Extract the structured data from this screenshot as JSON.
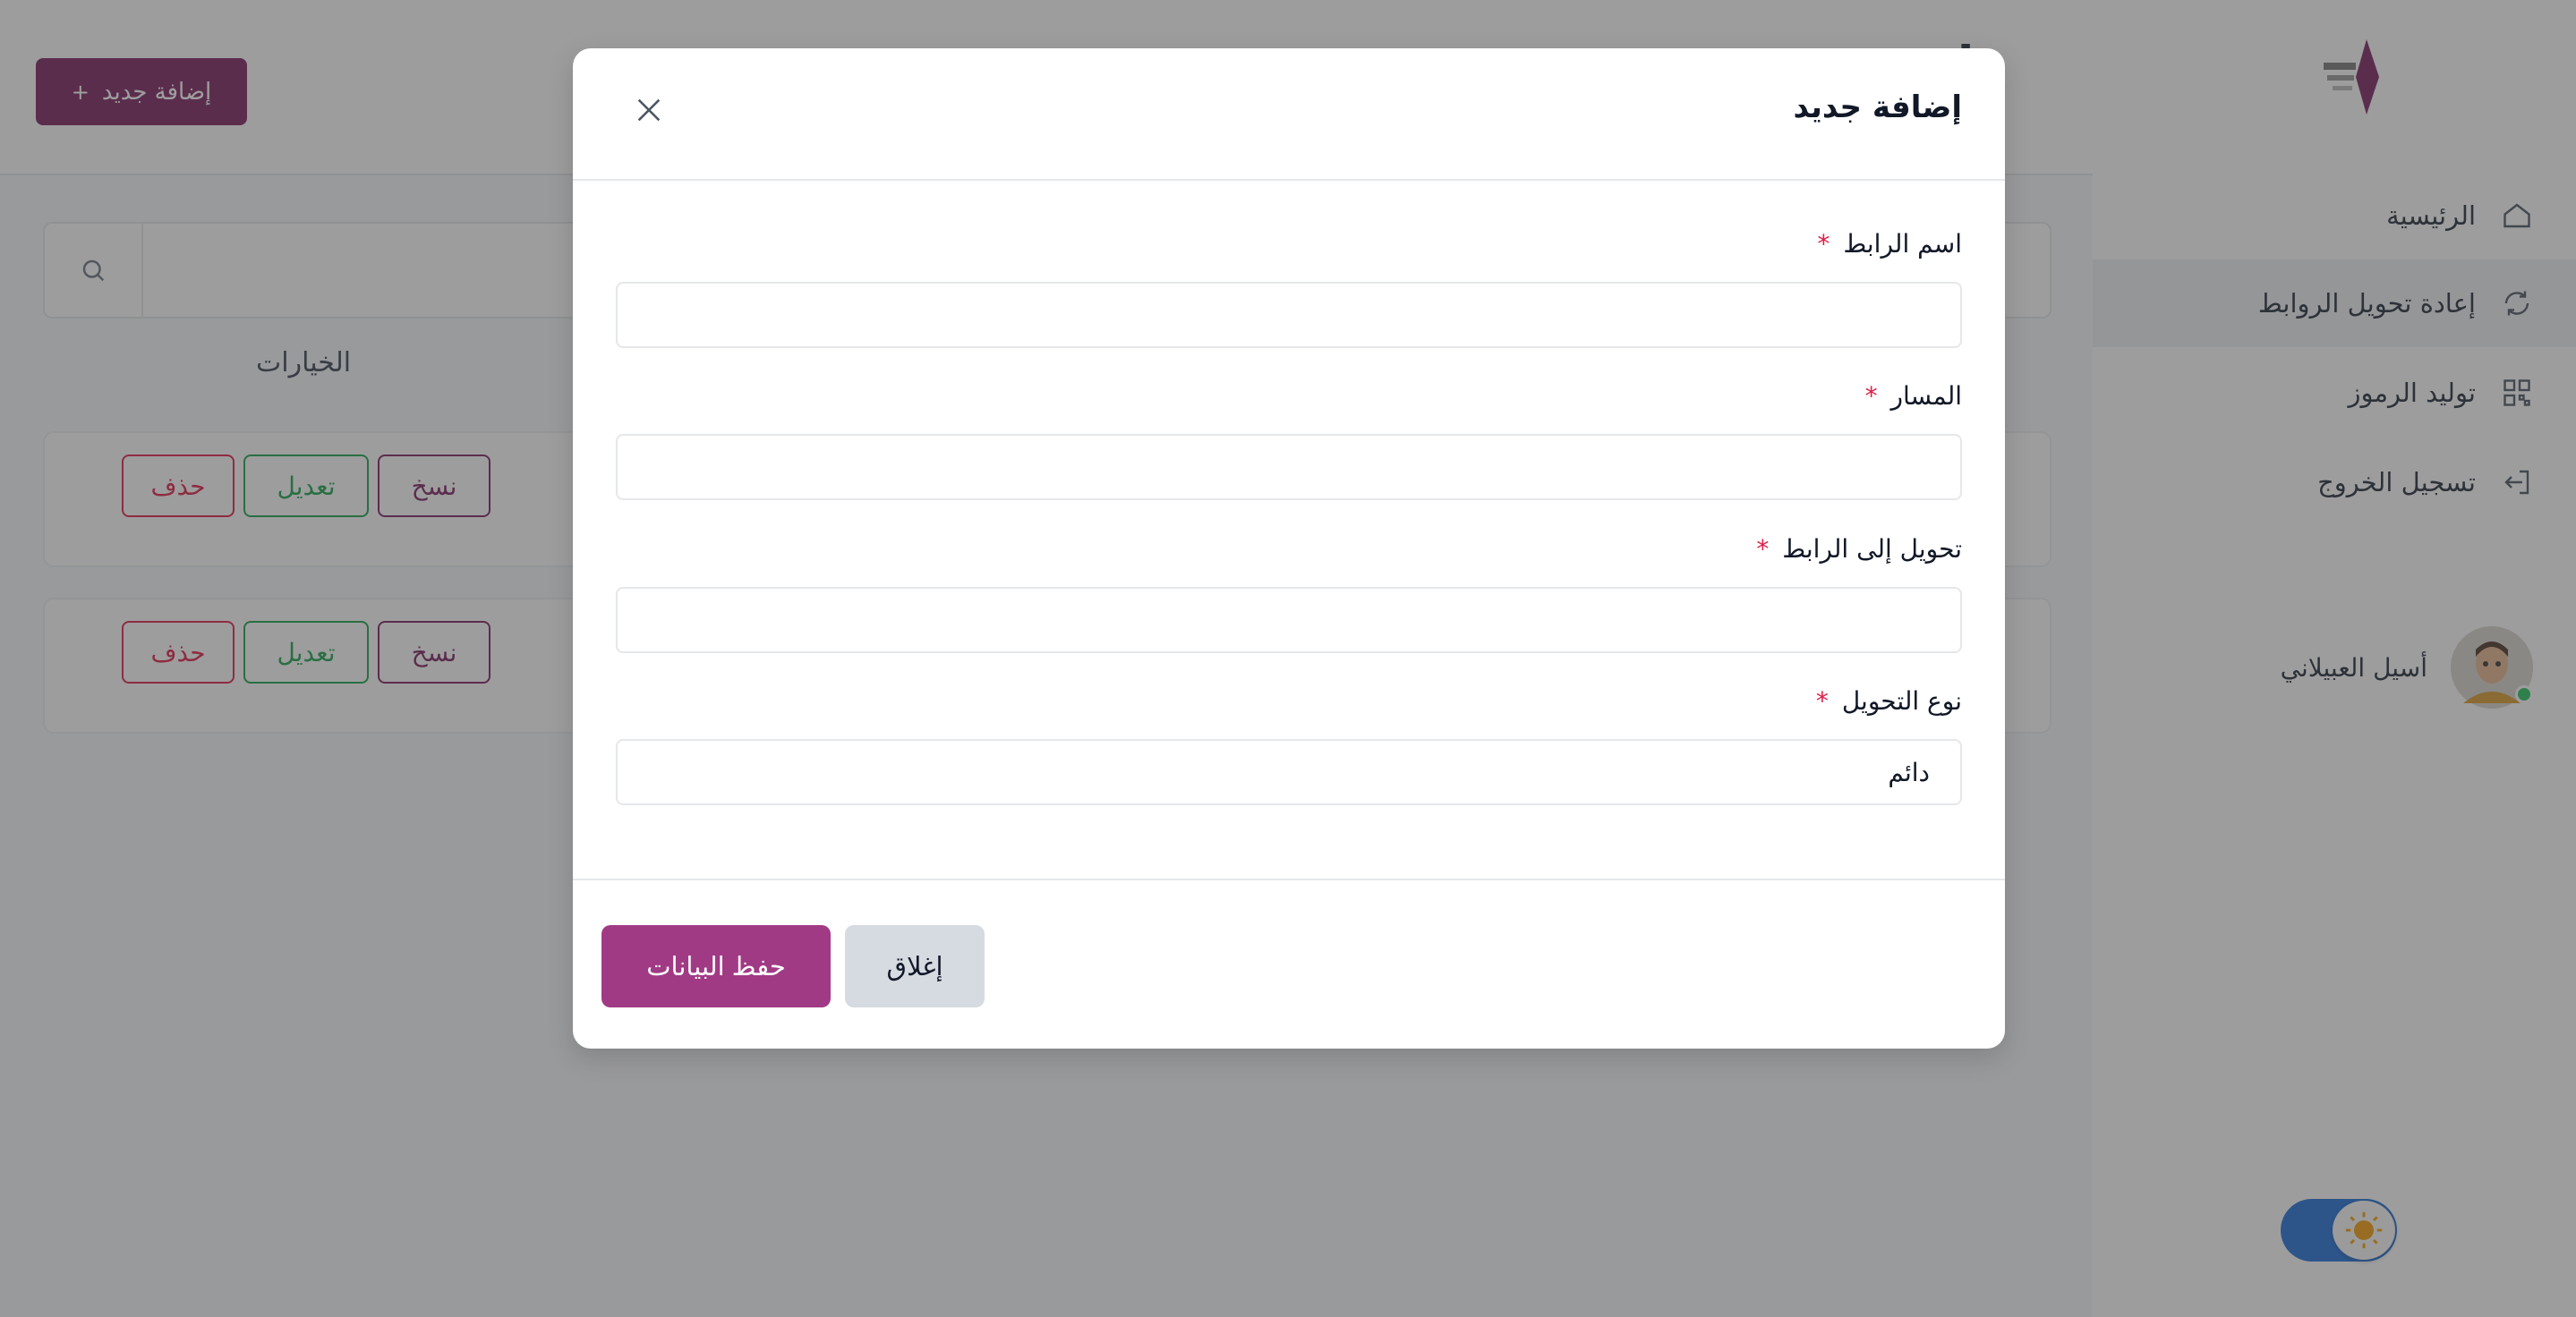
{
  "sidebar": {
    "items": [
      {
        "label": "الرئيسية",
        "icon": "home-icon"
      },
      {
        "label": "إعادة تحويل الروابط",
        "icon": "refresh-icon"
      },
      {
        "label": "توليد الرموز",
        "icon": "qr-code-icon"
      },
      {
        "label": "تسجيل الخروج",
        "icon": "logout-icon"
      }
    ],
    "user_name": "أسيل العبيلاني"
  },
  "topbar": {
    "add_new_label": "إضافة جديد",
    "add_icon": "+",
    "page_title": "إع"
  },
  "table": {
    "options_header": "الخيارات",
    "row_actions": {
      "copy": "نسخ",
      "edit": "تعديل",
      "delete": "حذف"
    }
  },
  "modal": {
    "title": "إضافة جديد",
    "fields": {
      "link_name": {
        "label": "اسم الرابط",
        "required": "*",
        "value": ""
      },
      "path": {
        "label": "المسار",
        "required": "*",
        "value": ""
      },
      "redirect_to": {
        "label": "تحويل إلى الرابط",
        "required": "*",
        "value": ""
      },
      "redirect_type": {
        "label": "نوع التحويل",
        "required": "*",
        "value": "دائم"
      }
    },
    "save_label": "حفظ البيانات",
    "close_label": "إغلاق"
  },
  "colors": {
    "brand": "#7a1f5e",
    "save": "#a13a85",
    "required": "#e11d48"
  }
}
